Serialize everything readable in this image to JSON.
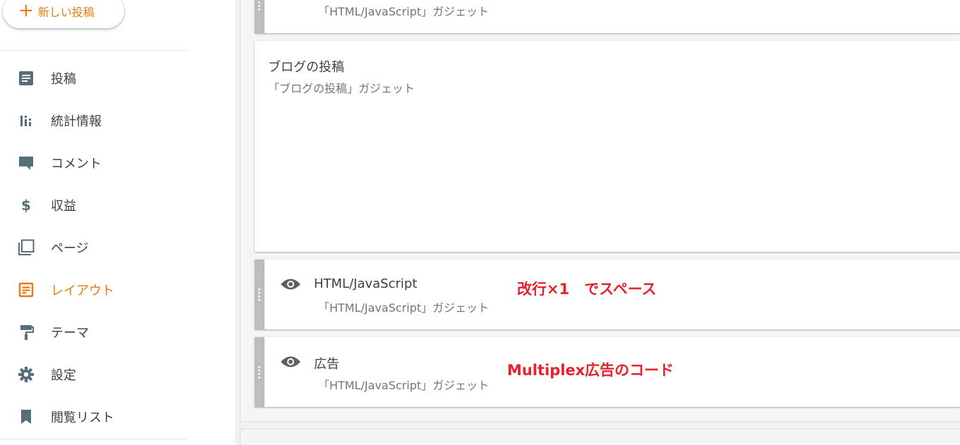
{
  "sidebar": {
    "new_post_label": "新しい投稿",
    "items": [
      {
        "label": "投稿",
        "icon": "posts-icon"
      },
      {
        "label": "統計情報",
        "icon": "stats-icon"
      },
      {
        "label": "コメント",
        "icon": "comment-icon"
      },
      {
        "label": "収益",
        "icon": "dollar-icon"
      },
      {
        "label": "ページ",
        "icon": "pages-icon"
      },
      {
        "label": "レイアウト",
        "icon": "layout-icon",
        "active": true
      },
      {
        "label": "テーマ",
        "icon": "paint-roller-icon"
      },
      {
        "label": "設定",
        "icon": "gear-icon"
      },
      {
        "label": "閲覧リスト",
        "icon": "bookmark-icon"
      }
    ]
  },
  "gadgets": [
    {
      "title": "",
      "subtitle": "「HTML/JavaScript」ガジェット"
    },
    {
      "title": "ブログの投稿",
      "subtitle": "「ブログの投稿」ガジェット"
    },
    {
      "title": "HTML/JavaScript",
      "subtitle": "「HTML/JavaScript」ガジェット"
    },
    {
      "title": "広告",
      "subtitle": "「HTML/JavaScript」ガジェット"
    }
  ],
  "annotations": {
    "note1": "改行×1　でスペース",
    "note2": "Multiplex広告のコード"
  },
  "colors": {
    "accent": "#e67c0f",
    "icon": "#546e7a",
    "annotation": "#e8212b",
    "handle": "#bdbdbd"
  }
}
